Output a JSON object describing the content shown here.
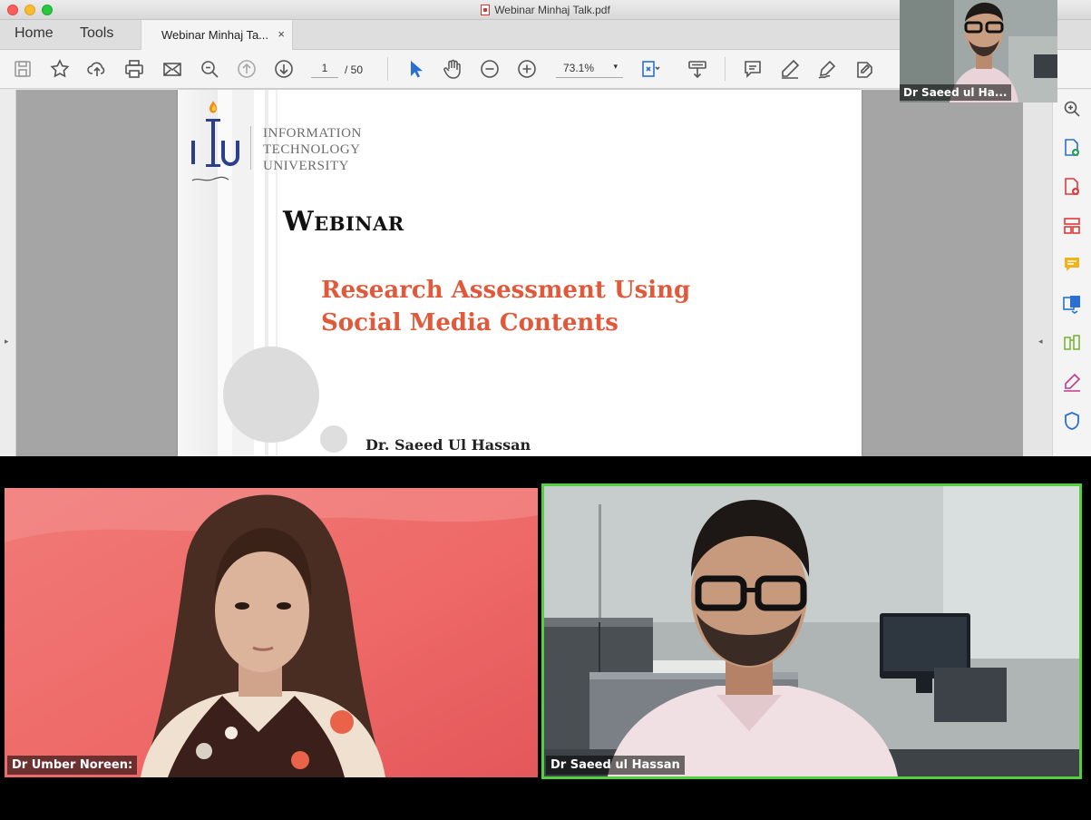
{
  "window": {
    "title": "Webinar Minhaj Talk.pdf"
  },
  "tabs": {
    "home": "Home",
    "tools": "Tools",
    "document": "Webinar Minhaj Ta...",
    "close": "×"
  },
  "toolbar": {
    "page_current": "1",
    "page_total": "/ 50",
    "zoom": "73.1%",
    "zoom_caret": "▾",
    "icons": [
      "save-icon",
      "bookmark-star-icon",
      "upload-cloud-icon",
      "print-icon",
      "email-icon",
      "zoom-search-icon",
      "page-up-icon",
      "page-down-icon",
      "select-arrow-icon",
      "hand-icon",
      "zoom-out-icon",
      "zoom-in-icon",
      "fit-page-icon",
      "scroll-mode-icon",
      "comment-icon",
      "pen-icon",
      "sign-icon",
      "fill-sign-icon"
    ]
  },
  "slide": {
    "logo_line1": "INFORMATION",
    "logo_line2": "TECHNOLOGY",
    "logo_line3": "UNIVERSITY",
    "heading": "Webinar",
    "title_line1": "Research Assessment Using",
    "title_line2": "Social Media Contents",
    "presenter": "Dr. Saeed Ul Hassan",
    "accent_color": "#e0593a"
  },
  "right_rail": {
    "icons": [
      "zoom-in-icon",
      "create-pdf-icon",
      "export-pdf-icon",
      "organize-pages-icon",
      "comment-icon",
      "send-file-icon",
      "compare-icon",
      "fill-sign-icon",
      "protect-shield-icon"
    ]
  },
  "participants": {
    "self_view_name": "Dr Saeed ul Ha...",
    "left_tile_name": "Dr Umber Noreen:",
    "right_tile_name": "Dr Saeed ul Hassan",
    "active_speaker_color": "#50d23a"
  },
  "handles": {
    "left_arrow": "▸",
    "right_arrow": "◂"
  }
}
